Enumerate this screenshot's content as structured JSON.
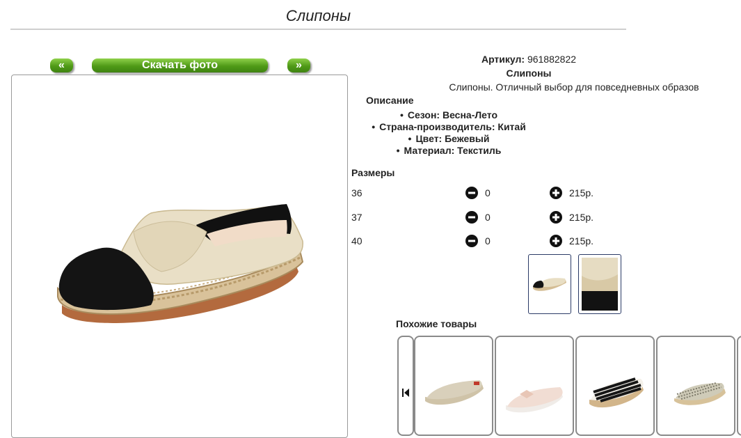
{
  "page": {
    "title": "Слипоны"
  },
  "buttons": {
    "prev": "«",
    "download": "Скачать фото",
    "next": "»"
  },
  "product": {
    "article_label": "Артикул:",
    "article_value": "961882822",
    "name": "Слипоны",
    "tagline": "Слипоны. Отличный выбор для повседневных образов",
    "description_heading": "Описание",
    "features": [
      "Сезон: Весна-Лето",
      "Страна-производитель: Китай",
      "Цвет: Бежевый",
      "Материал: Текстиль"
    ],
    "sizes_heading": "Размеры",
    "sizes": [
      {
        "size": "36",
        "qty": "0",
        "price": "215р."
      },
      {
        "size": "37",
        "qty": "0",
        "price": "215р."
      },
      {
        "size": "40",
        "qty": "0",
        "price": "215р."
      }
    ]
  },
  "similar": {
    "heading": "Похожие товары"
  },
  "icons": {
    "minus": "minus-circle-icon",
    "plus": "plus-circle-icon",
    "carousel_prev": "skip-back-icon"
  },
  "colors": {
    "button_green": "#4f9a17",
    "thumb_border": "#2a3a66"
  }
}
